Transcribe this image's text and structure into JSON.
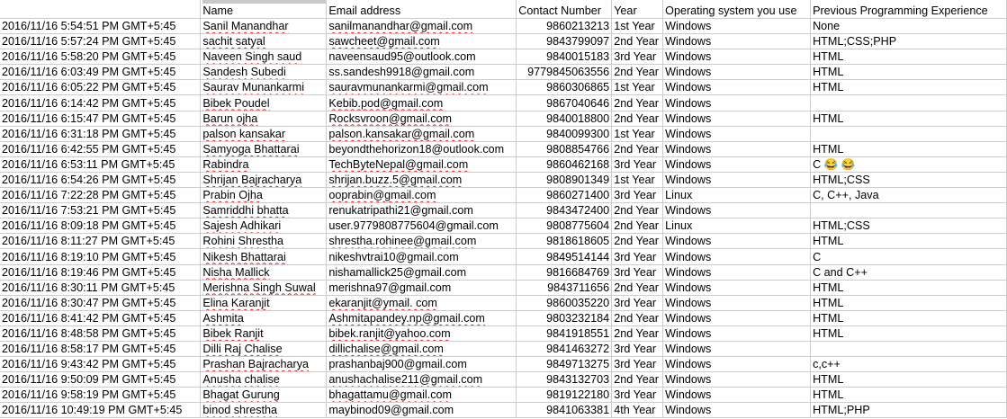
{
  "headers": [
    "",
    "Name",
    "Email address",
    "Contact Number",
    "Year",
    "Operating system you use",
    "Previous Programming Experience"
  ],
  "rows": [
    [
      "2016/11/16 5:54:51 PM GMT+5:45",
      "Sanil Manandhar",
      "sanilmanandhar@gmail.com",
      "9860213213",
      "1st Year",
      "Windows",
      "None"
    ],
    [
      "2016/11/16 5:57:24 PM GMT+5:45",
      "sachit satyal",
      "sawcheet@gmail.com",
      "9843799097",
      "2nd Year",
      "Windows",
      "HTML;CSS;PHP"
    ],
    [
      "2016/11/16 5:58:20 PM GMT+5:45",
      "Naveen Singh saud",
      "naveensaud95@outlook.com",
      "9840015183",
      "3rd Year",
      "Windows",
      "HTML"
    ],
    [
      "2016/11/16 6:03:49 PM GMT+5:45",
      "Sandesh Subedi",
      "ss.sandesh9918@gmail.com",
      "9779845063556",
      "2nd Year",
      "Windows",
      "HTML"
    ],
    [
      "2016/11/16 6:05:22 PM GMT+5:45",
      "Saurav Munankarmi",
      "sauravmunankarmi@gmail.com",
      "9860306865",
      "1st Year",
      "Windows",
      "HTML"
    ],
    [
      "2016/11/16 6:14:42 PM GMT+5:45",
      "Bibek Poudel",
      "Kebib.pod@gmail.com",
      "9867040646",
      "2nd Year",
      "Windows",
      ""
    ],
    [
      "2016/11/16 6:15:47 PM GMT+5:45",
      "Barun ojha",
      "Rocksvroon@gmail.com",
      "9840018800",
      "2nd Year",
      "Windows",
      "HTML"
    ],
    [
      "2016/11/16 6:31:18 PM GMT+5:45",
      "palson kansakar",
      "palson.kansakar@gmail.com",
      "9840099300",
      "1st Year",
      "Windows",
      ""
    ],
    [
      "2016/11/16 6:42:55 PM GMT+5:45",
      "Samyoga Bhattarai",
      "beyondthehorizon18@outlook.com",
      "9808854766",
      "2nd Year",
      "Windows",
      "HTML"
    ],
    [
      "2016/11/16 6:53:11 PM GMT+5:45",
      "Rabindra",
      "TechByteNepal@gmail.com",
      "9860462168",
      "3rd Year",
      "Windows",
      "C  😂 😂"
    ],
    [
      "2016/11/16 6:54:26 PM GMT+5:45",
      "Shrijan Bajracharya",
      "shrijan.buzz.5@gmail.com",
      "9808901349",
      "1st Year",
      "Windows",
      "HTML;CSS"
    ],
    [
      "2016/11/16 7:22:28 PM GMT+5:45",
      "Prabin Ojha",
      "ooprabin@gmail.com",
      "9860271400",
      "3rd Year",
      "Linux",
      "C, C++, Java"
    ],
    [
      "2016/11/16 7:53:21 PM GMT+5:45",
      "Samriddhi bhatta",
      "renukatripathi21@gmail.com",
      "9843472400",
      "2nd Year",
      "Windows",
      ""
    ],
    [
      "2016/11/16 8:09:18 PM GMT+5:45",
      "Sajesh Adhikari",
      "user.9779808775604@gmail.com",
      "9808775604",
      "2nd Year",
      "Linux",
      "HTML;CSS"
    ],
    [
      "2016/11/16 8:11:27 PM GMT+5:45",
      "Rohini Shrestha",
      "shrestha.rohinee@gmail.com",
      "9818618605",
      "2nd Year",
      "Windows",
      "HTML"
    ],
    [
      "2016/11/16 8:19:10 PM GMT+5:45",
      "Nikesh Bhattarai",
      "nikeshvtrai10@gmail.com",
      "9849514144",
      "3rd Year",
      "Windows",
      "C"
    ],
    [
      "2016/11/16 8:19:46 PM GMT+5:45",
      "Nisha Mallick",
      "nishamallick25@gmail.com",
      "9816684769",
      "3rd Year",
      "Windows",
      "C and C++"
    ],
    [
      "2016/11/16 8:30:11 PM GMT+5:45",
      "Merishna Singh Suwal",
      "merishna97@gmail.com",
      "9843711656",
      "2nd Year",
      "Windows",
      "HTML"
    ],
    [
      "2016/11/16 8:30:47 PM GMT+5:45",
      "Elina Karanjit",
      "ekaranjit@ymail. com",
      "9860035220",
      "3rd Year",
      "Windows",
      "HTML"
    ],
    [
      "2016/11/16 8:41:42 PM GMT+5:45",
      "Ashmita",
      "Ashmitapandey.np@gmail.com",
      "9803232184",
      "2nd Year",
      "Windows",
      "HTML"
    ],
    [
      "2016/11/16 8:48:58 PM GMT+5:45",
      "Bibek Ranjit",
      "bibek.ranjit@yahoo.com",
      "9841918551",
      "2nd Year",
      "Windows",
      "HTML"
    ],
    [
      "2016/11/16 8:58:17 PM GMT+5:45",
      "Dilli Raj Chalise",
      "dillichalise@gmail.com",
      "9841463272",
      "3rd Year",
      "Windows",
      ""
    ],
    [
      "2016/11/16 9:43:42 PM GMT+5:45",
      "Prashan Bajracharya",
      "prashanbaj900@gmail.com",
      "9849713275",
      "3rd Year",
      "Windows",
      "c,c++"
    ],
    [
      "2016/11/16 9:50:09 PM GMT+5:45",
      "Anusha chalise",
      "anushachalise211@gmail.com",
      "9843132703",
      "2nd Year",
      "Windows",
      "HTML"
    ],
    [
      "2016/11/16 9:58:19 PM GMT+5:45",
      "Bhagat Gurung",
      "bhagattamu@gmail.com",
      "9819122180",
      "3rd Year",
      "Windows",
      "HTML"
    ],
    [
      "2016/11/16 10:49:19 PM GMT+5:45",
      "binod shrestha",
      "maybinod09@gmail.com",
      "9841063381",
      "4th Year",
      "Windows",
      "HTML;PHP"
    ]
  ],
  "spellcheck_flagged": {
    "names": [
      "Sanil Manandhar",
      "sachit satyal",
      "Naveen Singh saud",
      "Sandesh Subedi",
      "Saurav Munankarmi",
      "Bibek Poudel",
      "Barun ojha",
      "palson kansakar",
      "Samyoga Bhattarai",
      "Rabindra",
      "Shrijan Bajracharya",
      "Prabin Ojha",
      "Samriddhi bhatta",
      "Sajesh Adhikari",
      "Rohini Shrestha",
      "Nikesh Bhattarai",
      "Nisha Mallick",
      "Merishna Singh Suwal",
      "Elina Karanjit",
      "Ashmita",
      "Bibek Ranjit",
      "Dilli Raj Chalise",
      "Prashan Bajracharya",
      "Anusha chalise",
      "Bhagat Gurung",
      "binod shrestha"
    ],
    "emails": [
      "sanilmanandhar@gmail.com",
      "sawcheet@gmail.com",
      "sauravmunankarmi@gmail.com",
      "Kebib.pod@gmail.com",
      "Rocksvroon@gmail.com",
      "palson.kansakar@gmail.com",
      "TechByteNepal@gmail.com",
      "shrijan.buzz.5@gmail.com",
      "ooprabin@gmail.com",
      "shrestha.rohinee@gmail.com",
      "ekaranjit@ymail. com",
      "Ashmitapandey.np@gmail.com",
      "bibek.ranjit@yahoo.com",
      "dillichalise@gmail.com",
      "anushachalise211@gmail.com",
      "bhagattamu@gmail.com"
    ]
  },
  "colors": {
    "gridline": "#cdcdcd",
    "spellcheck_underline": "#e02020",
    "column_selection": "#c7c9cc"
  }
}
